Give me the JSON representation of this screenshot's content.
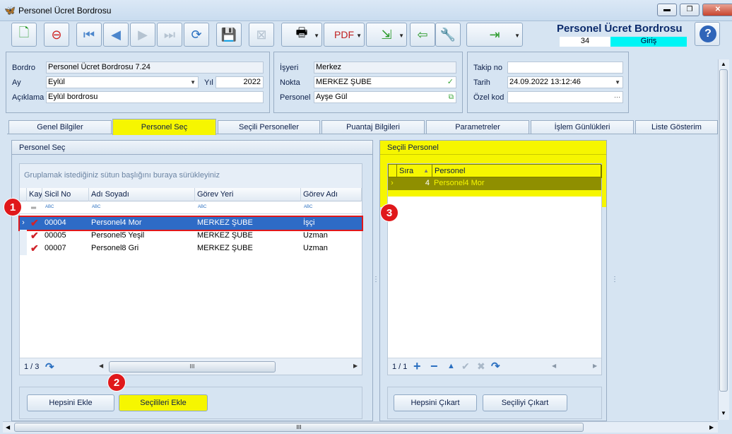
{
  "window": {
    "title": "Personel Ücret Bordrosu",
    "min": "▬",
    "max": "❐",
    "close": "✕"
  },
  "header": {
    "title": "Personel Ücret Bordrosu",
    "number": "34",
    "mode": "Giriş",
    "help": "?"
  },
  "toolbar_icons": [
    "new-doc-icon",
    "delete-doc-icon",
    "first-record-icon",
    "prev-record-icon",
    "next-record-icon",
    "last-record-icon",
    "refresh-icon",
    "save-icon",
    "save-cancel-icon",
    "print-icon",
    "pdf-icon",
    "export-icon",
    "import-icon",
    "tools-icon",
    "exit-icon"
  ],
  "form1": {
    "bordro_label": "Bordro",
    "bordro_value": "Personel Ücret Bordrosu 7.24",
    "ay_label": "Ay",
    "ay_value": "Eylül",
    "yil_label": "Yıl",
    "yil_value": "2022",
    "aciklama_label": "Açıklama",
    "aciklama_value": "Eylül bordrosu"
  },
  "form2": {
    "isyeri_label": "İşyeri",
    "isyeri_value": "Merkez",
    "nokta_label": "Nokta",
    "nokta_value": "MERKEZ ŞUBE",
    "personel_label": "Personel",
    "personel_value": "Ayşe Gül"
  },
  "form3": {
    "takip_label": "Takip no",
    "takip_value": "",
    "tarih_label": "Tarih",
    "tarih_value": "24.09.2022 13:12:46",
    "ozel_label": "Özel kod",
    "ozel_value": "",
    "ozel_btn": "···"
  },
  "tabs": [
    "Genel Bilgiler",
    "Personel Seç",
    "Seçili Personeller",
    "Puantaj Bilgileri",
    "Parametreler",
    "İşlem Günlükleri",
    "Liste Gösterim"
  ],
  "left_panel": {
    "title": "Personel Seç",
    "group_hint": "Gruplamak istediğiniz sütun başlığını buraya sürükleyiniz",
    "columns": [
      "Kay",
      "Sicil No",
      "Adı Soyadı",
      "Görev Yeri",
      "Görev Adı"
    ],
    "filter_icon": "ABC",
    "rows": [
      {
        "sicil": "00004",
        "ad": "Personel4 Mor",
        "yer": "MERKEZ ŞUBE",
        "gorev": "İşçi"
      },
      {
        "sicil": "00005",
        "ad": "Personel5 Yeşil",
        "yer": "MERKEZ ŞUBE",
        "gorev": "Uzman"
      },
      {
        "sicil": "00007",
        "ad": "Personel8 Gri",
        "yer": "MERKEZ ŞUBE",
        "gorev": "Uzman"
      }
    ],
    "pager": "1 / 3",
    "scroll_grip": "III",
    "btn_all": "Hepsini Ekle",
    "btn_selected": "Seçilileri Ekle"
  },
  "right_panel": {
    "title": "Seçili Personel",
    "columns": [
      "Sıra",
      "Personel"
    ],
    "rows": [
      {
        "sira": "4",
        "personel": "Personel4 Mor"
      }
    ],
    "pager": "1 / 1",
    "btn_remove_all": "Hepsini Çıkart",
    "btn_remove_sel": "Seçiliyi Çıkart"
  },
  "badges": [
    "1",
    "2",
    "3"
  ],
  "colors": {
    "highlight": "#f6f600",
    "selected_row": "#2e6bc6",
    "badge": "#e0181b",
    "mode_bg": "#00f5f5"
  }
}
